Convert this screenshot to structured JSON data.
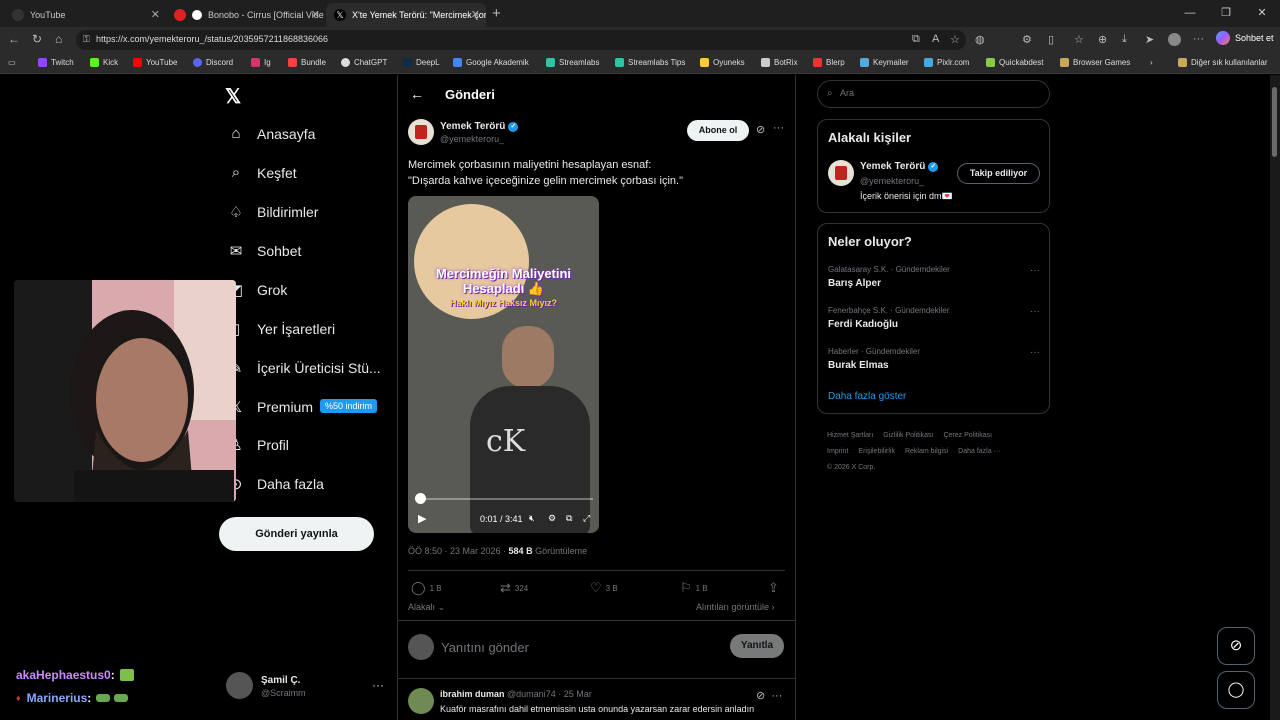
{
  "browser": {
    "tabs": [
      {
        "title": "YouTube",
        "active": false
      },
      {
        "title": "Bonobo - Cirrus [Official Vide",
        "active": false
      },
      {
        "title": "X'te Yemek Terörü: \"Mercimek çorb",
        "active": true
      }
    ],
    "url": "https://x.com/yemekteroru_/status/2035957211868836066",
    "sohbet_label": "Sohbet et",
    "bookmarks": [
      "Twitch",
      "Kick",
      "YouTube",
      "Discord",
      "Ig",
      "Bundle",
      "ChatGPT",
      "DeepL",
      "Google Akademik",
      "Streamlabs",
      "Streamlabs Tips",
      "Oyuneks",
      "BotRix",
      "Blerp",
      "Keymailer",
      "Pixlr.com",
      "Quickabdest",
      "Browser Games"
    ],
    "other_bookmarks": "Diğer sık kullanılanlar"
  },
  "nav": {
    "items": [
      "Anasayfa",
      "Keşfet",
      "Bildirimler",
      "Sohbet",
      "Grok",
      "Yer İşaretleri",
      "İçerik Üreticisi Stü...",
      "Premium",
      "Profil",
      "Daha fazla"
    ],
    "premium_badge": "%50 indirim",
    "post_button": "Gönderi yayınla",
    "user": {
      "name": "Şamil Ç.",
      "handle": "@Scraimm"
    }
  },
  "stream_chat": [
    {
      "user": "akaHephaestus0",
      "sep": " :",
      "color": "#c98bff"
    },
    {
      "user": "Marinerius",
      "sep": " :",
      "color": "#8aa7ff"
    }
  ],
  "main": {
    "title": "Gönderi",
    "tweet": {
      "author": "Yemek Terörü",
      "handle": "@yemekteroru_",
      "subscribe": "Abone ol",
      "text_line1": "Mercimek çorbasının maliyetini hesaplayan esnaf:",
      "text_line2": "\"Dışarda kahve içeceğinize gelin mercimek çorbası için.\"",
      "video_title_line1": "Mercimeğin Maliyetini",
      "video_title_line2": "Hesapladı 👍",
      "video_subtitle": "Haklı Mıyız Haksız Mıyız?",
      "video_time": "0:01 / 3:41",
      "video_progress": 0.005,
      "time": "ÖÖ 8:50 · 23 Mar 2026 · ",
      "views": "584 B",
      "views_label": " Görüntüleme",
      "replies": "1 B",
      "reposts": "324",
      "likes": "3 B",
      "bookmarks": "1 B",
      "relevant": "Alakalı",
      "quotes": "Alıntıları görüntüle"
    },
    "reply_placeholder": "Yanıtını gönder",
    "reply_button": "Yanıtla",
    "reply": {
      "name": "ibrahim duman",
      "meta": "@dumani74 · 25 Mar",
      "text": "Kuaför masrafını dahil etmemissin usta onunda yazarsan zarar edersin anladın"
    }
  },
  "sidebar": {
    "search_placeholder": "Ara",
    "related_title": "Alakalı kişiler",
    "related": {
      "name": "Yemek Terörü",
      "handle": "@yemekteroru_",
      "bio": "İçerik önerisi için dm💌",
      "button": "Takip ediliyor"
    },
    "trends_title": "Neler oluyor?",
    "trends": [
      {
        "category": "Galatasaray S.K. · Gündemdekiler",
        "name": "Barış Alper"
      },
      {
        "category": "Fenerbahçe S.K. · Gündemdekiler",
        "name": "Ferdi Kadıoğlu"
      },
      {
        "category": "Haberler · Gündemdekiler",
        "name": "Burak Elmas"
      }
    ],
    "show_more": "Daha fazla göster",
    "footer": [
      "Hizmet Şartları",
      "Gizlilik Politikası",
      "Çerez Politikası",
      "Imprint",
      "Erişilebilirlik",
      "Reklam bilgisi",
      "Daha fazla ···",
      "© 2026 X Corp."
    ]
  }
}
